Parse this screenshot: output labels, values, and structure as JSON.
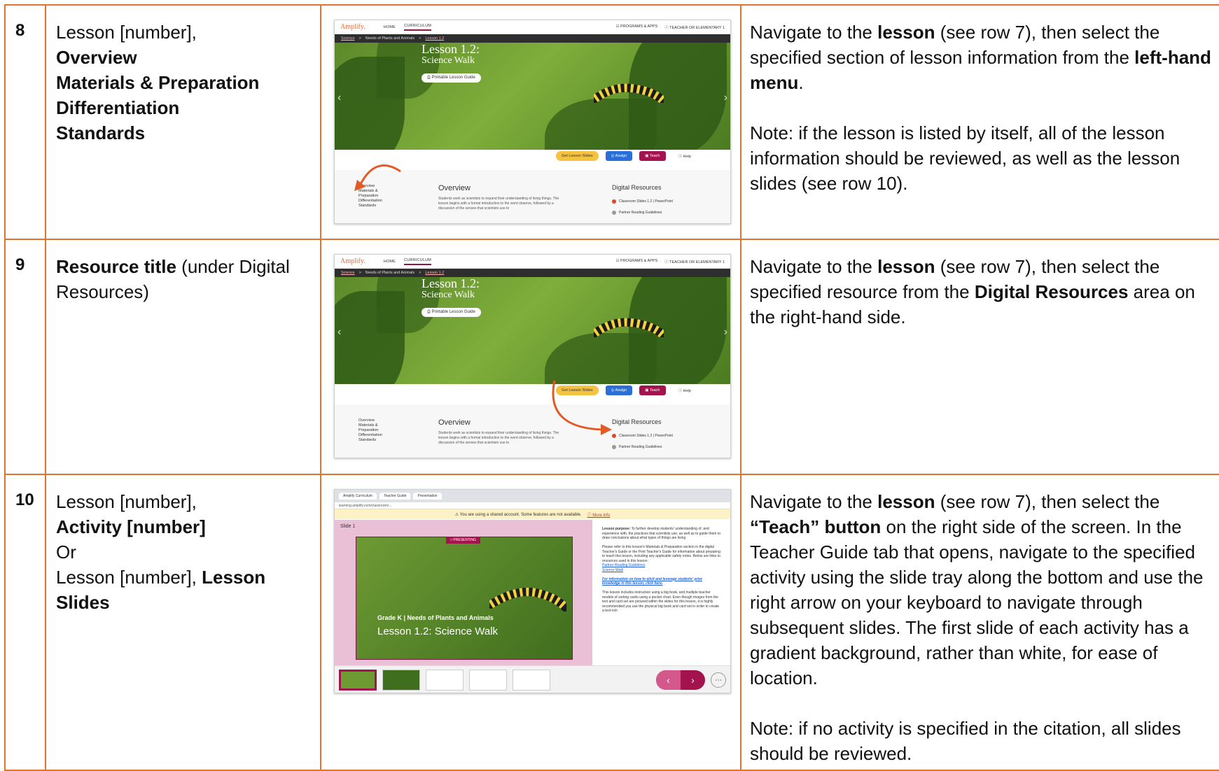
{
  "rows": [
    {
      "number": "8",
      "label_line1": "Lesson [number],",
      "bold_lines": [
        "Overview",
        "Materials & Preparation",
        "Differentiation",
        "Standards"
      ],
      "instruction_p1_a": "Navigate to the ",
      "instruction_p1_b": "lesson",
      "instruction_p1_c": " (see row 7), then select the specified section of lesson information from the ",
      "instruction_p1_d": "left-hand menu",
      "instruction_p1_e": ".",
      "instruction_p2": "Note: if the lesson is listed by itself, all of the lesson information should be reviewed, as well as the lesson slides (see row 10)."
    },
    {
      "number": "9",
      "label_bold": "Resource title",
      "label_rest": " (under Digital Resources)",
      "instruction_p1_a": "Navigate to the ",
      "instruction_p1_b": "lesson",
      "instruction_p1_c": " (see row 7), then select the specified resource from the ",
      "instruction_p1_d": "Digital Resources",
      "instruction_p1_e": " area on the right-hand side."
    },
    {
      "number": "10",
      "label_line1": "Lesson [number],",
      "label_bold2": "Activity [number]",
      "label_or": "Or",
      "label_line4": "Lesson [number], ",
      "label_bold4": "Lesson Slides",
      "instruction_p1_a": "Navigate to the ",
      "instruction_p1_b": "lesson",
      "instruction_p1_c": " (see row 7), then select the ",
      "instruction_p1_d": "“Teach” button",
      "instruction_p1_e": " on the right side of the screen. In the Teacher Guide tab that opens, navigate to the specified activity using the slide tray along the bottom and use the right arrow on your keyboard to navigate through subsequent slides. The first slide of each activity has a gradient background, rather than white, for ease of location.",
      "instruction_p2": "Note: if no activity is specified in the citation, all slides should be reviewed."
    }
  ],
  "lesson_page": {
    "logo": "Amplify.",
    "nav_home": "HOME",
    "nav_curriculum": "CURRICULUM",
    "nav_programs": "☷ PROGRAMS & APPS",
    "nav_account": "ⓘ TEACHER OR ELEMENTARY 1",
    "crumb_science": "Science",
    "crumb_unit": "Needs of Plants and Animals",
    "crumb_lesson": "Lesson 1.2",
    "hero_title": "Lesson 1.2:",
    "hero_subtitle": "Science Walk",
    "print_button": "⎙ Printable Lesson Guide",
    "btn_slides": "Get Lesson Slides",
    "btn_assign": "◎ Assign",
    "btn_teach": "▣ Teach",
    "btn_help": "ⓘ Help",
    "menu": [
      "Overview",
      "Materials &",
      "Preparation",
      "Differentiation",
      "Standards"
    ],
    "overview_title": "Overview",
    "overview_text": "Students work as scientists to expand their understanding of living things. The lesson begins with a formal introduction to the word observe, followed by a discussion of the senses that scientists use to",
    "dr_title": "Digital Resources",
    "dr_item1": "Classroom Slides 1.2 | PowerPoint",
    "dr_item2": "Partner Reading Guidelines"
  },
  "teacher_guide": {
    "tab1": "Amplify Curriculum",
    "tab2": "Teacher Guide",
    "tab3": "Presentation",
    "url": "learning.amplify.com/classroom/...",
    "warning": "⚠ You are using a shared account. Some features are not available.",
    "more_info": "ⓘ More info",
    "slide_label": "Slide 1",
    "presenting": "□ PRESENTING",
    "grade": "Grade K | Needs of Plants and Animals",
    "lesson": "Lesson 1.2: Science Walk",
    "notes_purpose_bold": "Lesson purpose:",
    "notes_purpose": " To further develop students' understanding of, and experience with, the practices that scientists use, as well as to guide them to draw conclusions about what types of things are living",
    "notes_refer": "Please refer to this lesson's Materials & Preparation section in the digital Teacher's Guide or the Print Teacher's Guide for information about preparing to teach this lesson, including any applicable safety notes. Below are links to resources used in this lesson.",
    "link1": "Partner Reading Guidelines",
    "link2": "Science Walk",
    "link3": "For information on how to elicit and leverage students' prior knowledge in this lesson, click here.",
    "notes_more": "This lesson includes instruction using a big book, and multiple teacher models of sorting cards using a pocket chart. Even though images from the text and card set are pictured within the slides for this lesson, it is highly recommended you use the physical big book and card set in order to create a text-rich",
    "prev": "‹",
    "next": "›",
    "more": "⋯"
  }
}
